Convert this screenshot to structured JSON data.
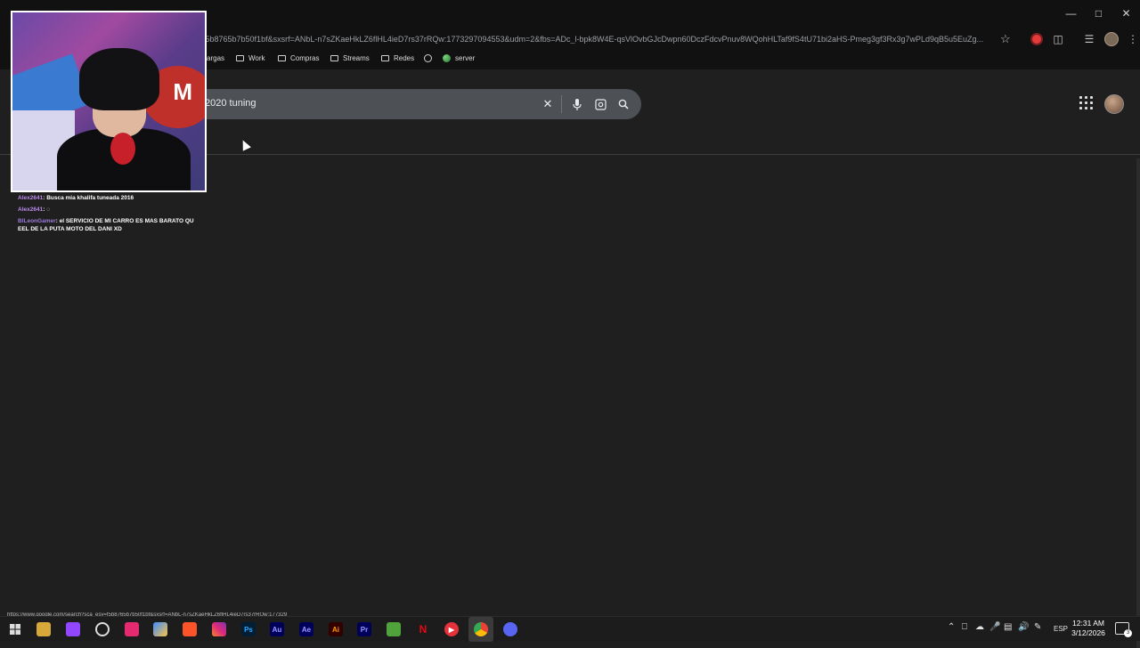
{
  "browser": {
    "url": "f5b8765b7b50f1bf&sxsrf=ANbL-n7sZKaeHkLZ6flHL4ieD7rs37rRQw:1773297094553&udm=2&fbs=ADc_l-bpk8W4E-qsVlOvbGJcDwpn60DczFdcvPnuv8WQohHLTaf9fS4tU71bi2aHS-Pmeg3gf3Rx3g7wPLd9qB5u5EuZg...",
    "status_url": "https://www.google.com/search?sca_esv=f5b8765b7b50f1bf&sxsrf=ANbL-n7sZKaeHkLZ6flHL4ieD7rs37rRQw:177329",
    "bookmarks": [
      {
        "label": "argas",
        "icon": "folder-icon"
      },
      {
        "label": "Work",
        "icon": "folder-icon"
      },
      {
        "label": "Compras",
        "icon": "folder-icon"
      },
      {
        "label": "Streams",
        "icon": "folder-icon"
      },
      {
        "label": "Redes",
        "icon": "folder-icon"
      },
      {
        "label": "",
        "icon": "github-icon"
      },
      {
        "label": "server",
        "icon": "server-icon"
      }
    ]
  },
  "search": {
    "query": "2020 tuning"
  },
  "chat": [
    {
      "user": "Alex2641",
      "text": "Busca mia khalifa tuneada 2016"
    },
    {
      "user": "Alex2641",
      "text": "◌"
    },
    {
      "user": "BlLeonGamer",
      "text": "el SERVICIO DE MI CARRO ES MAS BARATO QU EEL DE LA PUTA MOTO DEL DANI XD"
    }
  ],
  "taskbar": {
    "apps": [
      "Ps",
      "Au",
      "Ae",
      "Ai",
      "Pr"
    ],
    "language": "ESP",
    "time": "12:31 AM",
    "date": "3/12/2026",
    "notifications": "3"
  },
  "colors": {
    "page_bg": "#1f1f1f",
    "searchbox_bg": "#4d5156",
    "chrome_bg": "#111111",
    "taskbar_bg": "#1c1c1c"
  }
}
